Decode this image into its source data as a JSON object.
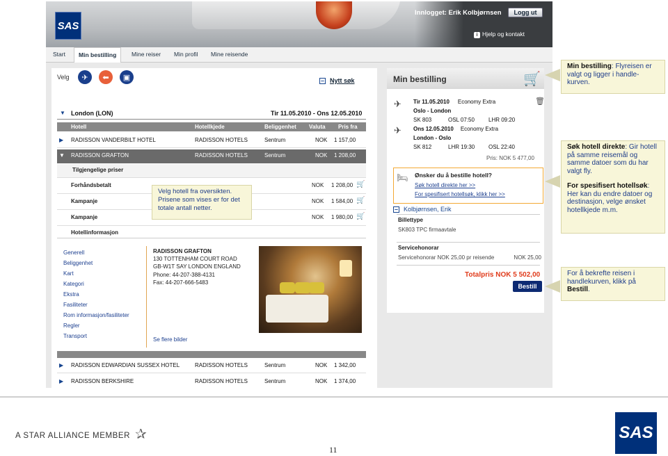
{
  "header": {
    "logo": "SAS",
    "login_text": "Innlogget: Erik Kolbjørnsen",
    "logout_label": "Logg ut",
    "help_label": "Hjelp og kontakt",
    "help_icon": "i"
  },
  "nav": {
    "tabs": [
      "Start",
      "Min bestilling",
      "Mine reiser",
      "Min profil",
      "Mine reisende"
    ],
    "active": "Min bestilling"
  },
  "left": {
    "velg_label": "Velg",
    "nytt_sok_label": "Nytt søk",
    "location": "London (LON)",
    "date_range": "Tir 11.05.2010 - Ons 12.05.2010",
    "columns": [
      "Hotell",
      "Hotellkjede",
      "Beliggenhet",
      "Valuta",
      "Pris fra"
    ],
    "hotels": [
      {
        "name": "RADISSON VANDERBILT HOTEL",
        "chain": "RADISSON HOTELS",
        "location": "Sentrum",
        "currency": "NOK",
        "price": "1 157,00"
      },
      {
        "name": "RADISSON GRAFTON",
        "chain": "RADISSON HOTELS",
        "location": "Sentrum",
        "currency": "NOK",
        "price": "1 208,00"
      }
    ],
    "available_prices_label": "Tilgjengelige priser",
    "price_rows": [
      {
        "label": "Forhåndsbetalt",
        "currency": "NOK",
        "price": "1 208,00"
      },
      {
        "label": "Kampanje",
        "currency": "NOK",
        "price": "1 584,00"
      },
      {
        "label": "Kampanje",
        "currency": "NOK",
        "price": "1 980,00"
      }
    ],
    "tooltip": "Velg hotell fra oversikten. Prisene som vises er  for det totale antall netter.",
    "hotelinfo_label": "Hotellinformasjon",
    "info_links": [
      "Generell",
      "Beliggenhet",
      "Kart",
      "Kategori",
      "Ekstra",
      "Fasiliteter",
      "Rom informasjon/fasiliteter",
      "Regler",
      "Transport"
    ],
    "address": {
      "name": "RADISSON GRAFTON",
      "street": "130 TOTTENHAM COURT ROAD",
      "city": "GB-W1T SAY LONDON ENGLAND",
      "phone": "Phone: 44-207-388-4131",
      "fax": "Fax: 44-207-666-5483"
    },
    "more_images": "Se flere bilder",
    "more_hotels": [
      {
        "name": "RADISSON EDWARDIAN SUSSEX HOTEL",
        "chain": "RADISSON HOTELS",
        "location": "Sentrum",
        "currency": "NOK",
        "price": "1 342,00"
      },
      {
        "name": "RADISSON BERKSHIRE",
        "chain": "RADISSON HOTELS",
        "location": "Sentrum",
        "currency": "NOK",
        "price": "1 374,00"
      }
    ]
  },
  "right": {
    "title": "Min bestilling",
    "flights": [
      {
        "date": "Tir 11.05.2010",
        "cabin": "Economy Extra",
        "route": "Oslo - London",
        "flight": "SK 803",
        "dep": "OSL 07:50",
        "arr": "LHR 09:20"
      },
      {
        "date": "Ons 12.05.2010",
        "cabin": "Economy Extra",
        "route": "London - Oslo",
        "flight": "SK 812",
        "dep": "LHR 19:30",
        "arr": "OSL 22:40"
      }
    ],
    "price": "Pris: NOK 5 477,00",
    "hotel_q": "Ønsker du å bestille hotell?",
    "hotel_link1": "Søk hotell direkte her >>",
    "hotel_link2": "For spesifisert hotellsøk, klikk her >>",
    "passenger": "Kolbjørnsen, Erik",
    "ticket_label": "Billettype",
    "ticket_value": "SK803    TPC firmaavtale",
    "service_label": "Servicehonorar",
    "service_value": "Servicehonorar NOK 25,00 pr reisende",
    "service_amount": "NOK 25,00",
    "total": "Totalpris NOK 5 502,00",
    "book_label": "Bestill"
  },
  "callouts": {
    "c1_bold": "Min bestilling",
    "c1_text": ": Flyreisen er valgt og ligger i handle-kurven.",
    "c2_bold": "Søk hotell direkte",
    "c2_text": ": Gir hotell på samme reisemål og samme datoer som du har valgt fly.",
    "c3_bold": "For spesifisert hotellsøk",
    "c3_text": ": Her kan du endre datoer og destinasjon, velge ønsket hotellkjede m.m.",
    "c4_text": "For å bekrefte reisen i handlekurven, klikk på ",
    "c4_bold": "Bestill",
    "c4_end": "."
  },
  "footer": {
    "alliance": "A STAR ALLIANCE MEMBER",
    "page_number": "11",
    "logo": "SAS"
  },
  "colors": {
    "sas_blue": "#00307a",
    "link_blue": "#1c3f8f",
    "accent_orange": "#f3a933",
    "total_red": "#e03b1b"
  }
}
